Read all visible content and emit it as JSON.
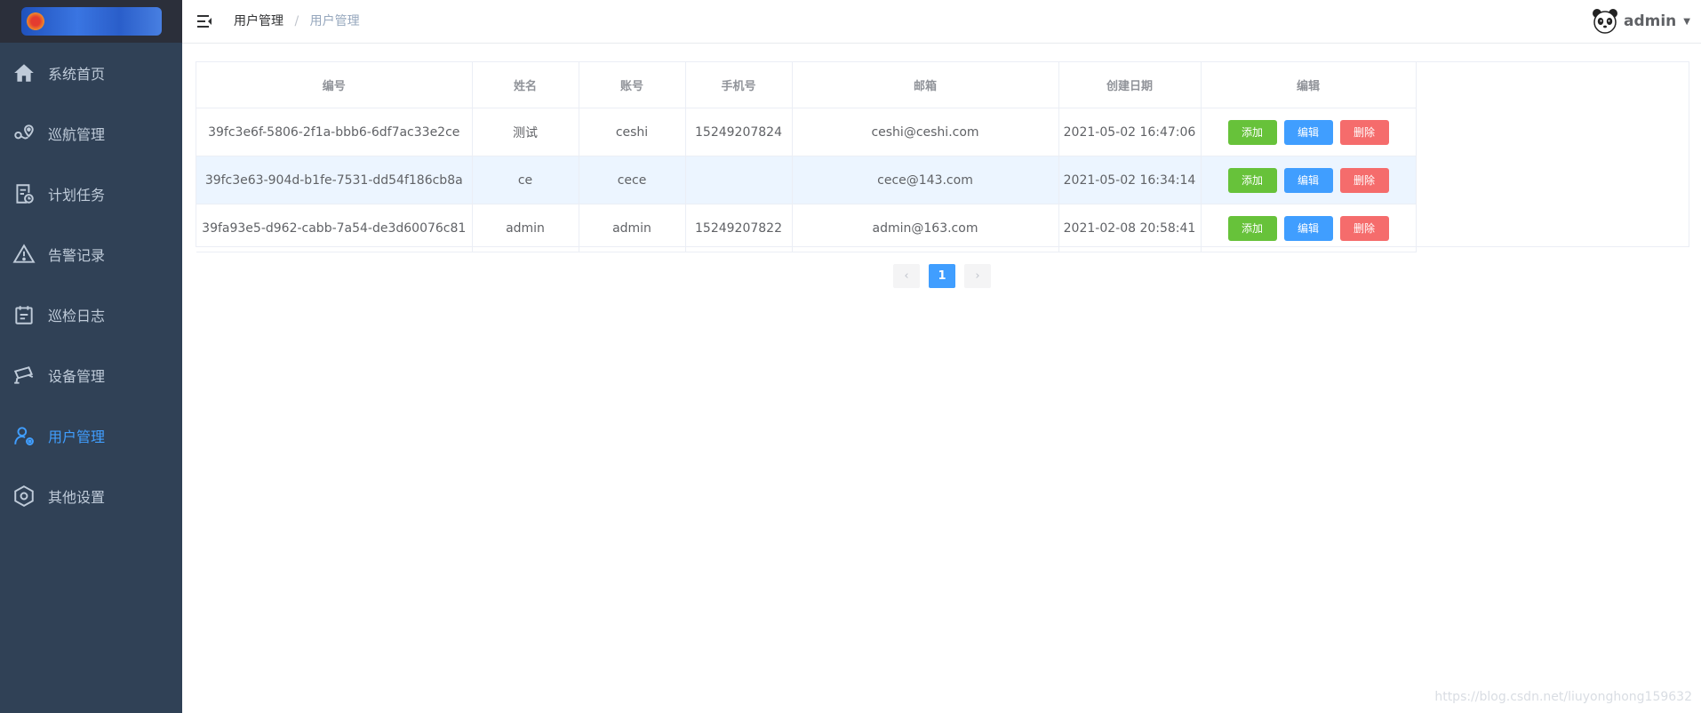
{
  "sidebar": {
    "items": [
      {
        "label": "系统首页",
        "icon": "home-icon",
        "active": false
      },
      {
        "label": "巡航管理",
        "icon": "route-icon",
        "active": false
      },
      {
        "label": "计划任务",
        "icon": "task-icon",
        "active": false
      },
      {
        "label": "告警记录",
        "icon": "warning-icon",
        "active": false
      },
      {
        "label": "巡检日志",
        "icon": "log-icon",
        "active": false
      },
      {
        "label": "设备管理",
        "icon": "camera-icon",
        "active": false
      },
      {
        "label": "用户管理",
        "icon": "user-icon",
        "active": true
      },
      {
        "label": "其他设置",
        "icon": "settings-icon",
        "active": false
      }
    ]
  },
  "header": {
    "breadcrumb": {
      "first": "用户管理",
      "separator": "/",
      "current": "用户管理"
    },
    "user": {
      "name": "admin"
    }
  },
  "table": {
    "columns": [
      "编号",
      "姓名",
      "账号",
      "手机号",
      "邮箱",
      "创建日期",
      "编辑"
    ],
    "rows": [
      {
        "id": "39fc3e6f-5806-2f1a-bbb6-6df7ac33e2ce",
        "name": "测试",
        "account": "ceshi",
        "phone": "15249207824",
        "email": "ceshi@ceshi.com",
        "created": "2021-05-02 16:47:06"
      },
      {
        "id": "39fc3e63-904d-b1fe-7531-dd54f186cb8a",
        "name": "ce",
        "account": "cece",
        "phone": "",
        "email": "cece@143.com",
        "created": "2021-05-02 16:34:14"
      },
      {
        "id": "39fa93e5-d962-cabb-7a54-de3d60076c81",
        "name": "admin",
        "account": "admin",
        "phone": "15249207822",
        "email": "admin@163.com",
        "created": "2021-02-08 20:58:41"
      }
    ],
    "actions": {
      "add": "添加",
      "edit": "编辑",
      "delete": "删除"
    }
  },
  "pagination": {
    "prev": "‹",
    "current": "1",
    "next": "›"
  },
  "watermark": "https://blog.csdn.net/liuyonghong159632",
  "colors": {
    "sidebar_bg": "#304156",
    "active": "#409eff",
    "add": "#67c23a",
    "edit": "#409eff",
    "delete": "#f56c6c"
  }
}
